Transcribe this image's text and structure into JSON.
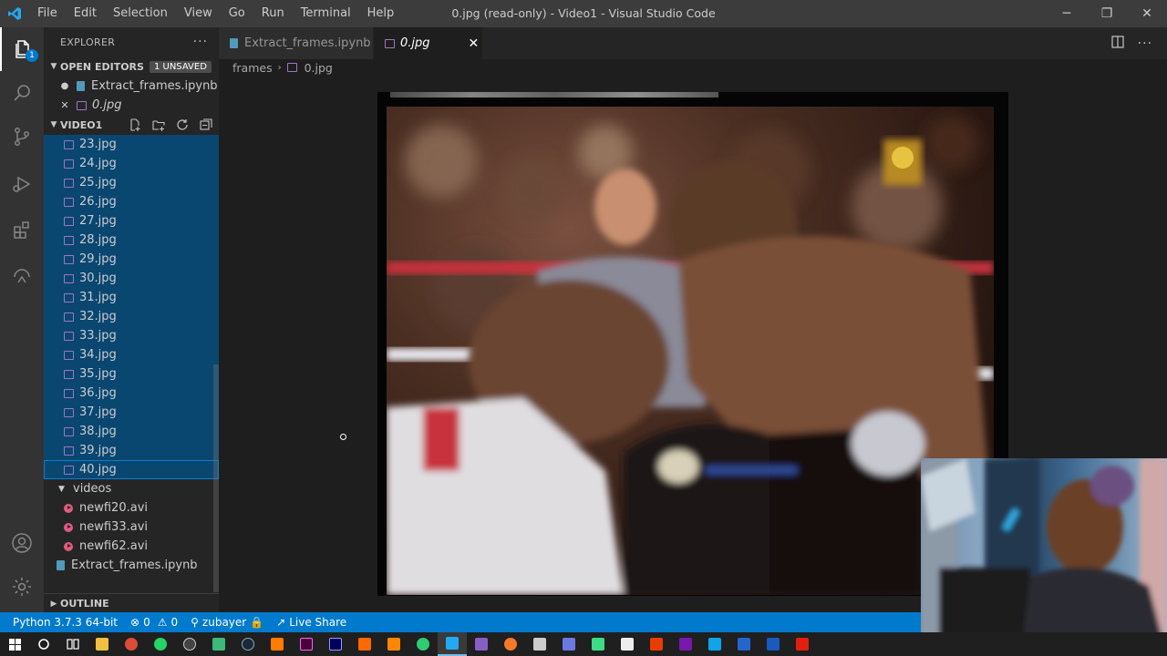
{
  "window": {
    "title": "0.jpg (read-only) - Video1 - Visual Studio Code",
    "menu": [
      "File",
      "Edit",
      "Selection",
      "View",
      "Go",
      "Run",
      "Terminal",
      "Help"
    ]
  },
  "activity": {
    "explorer_badge": "1"
  },
  "explorer": {
    "title": "EXPLORER",
    "open_editors": {
      "label": "OPEN EDITORS",
      "badge": "1 UNSAVED",
      "items": [
        {
          "name": "Extract_frames.ipynb",
          "mark": "●"
        },
        {
          "name": "0.jpg",
          "mark": "✕"
        }
      ]
    },
    "folder": {
      "label": "VIDEO1",
      "frames": [
        "23.jpg",
        "24.jpg",
        "25.jpg",
        "26.jpg",
        "27.jpg",
        "28.jpg",
        "29.jpg",
        "30.jpg",
        "31.jpg",
        "32.jpg",
        "33.jpg",
        "34.jpg",
        "35.jpg",
        "36.jpg",
        "37.jpg",
        "38.jpg",
        "39.jpg",
        "40.jpg"
      ],
      "videos_label": "videos",
      "videos": [
        "newfi20.avi",
        "newfi33.avi",
        "newfi62.avi"
      ],
      "notebook": "Extract_frames.ipynb"
    },
    "outline": "OUTLINE"
  },
  "tabs": [
    {
      "label": "Extract_frames.ipynb"
    },
    {
      "label": "0.jpg"
    }
  ],
  "breadcrumb": {
    "folder": "frames",
    "file": "0.jpg"
  },
  "status": {
    "python": "Python 3.7.3 64-bit",
    "errors": "0",
    "warnings": "0",
    "user": "zubayer",
    "liveshare": "Live Share"
  },
  "colors": {
    "statusbar": "#007acc",
    "selection": "#094771",
    "image_icon": "#a074c4",
    "video_icon": "#e05a80",
    "notebook_icon": "#519aba"
  }
}
